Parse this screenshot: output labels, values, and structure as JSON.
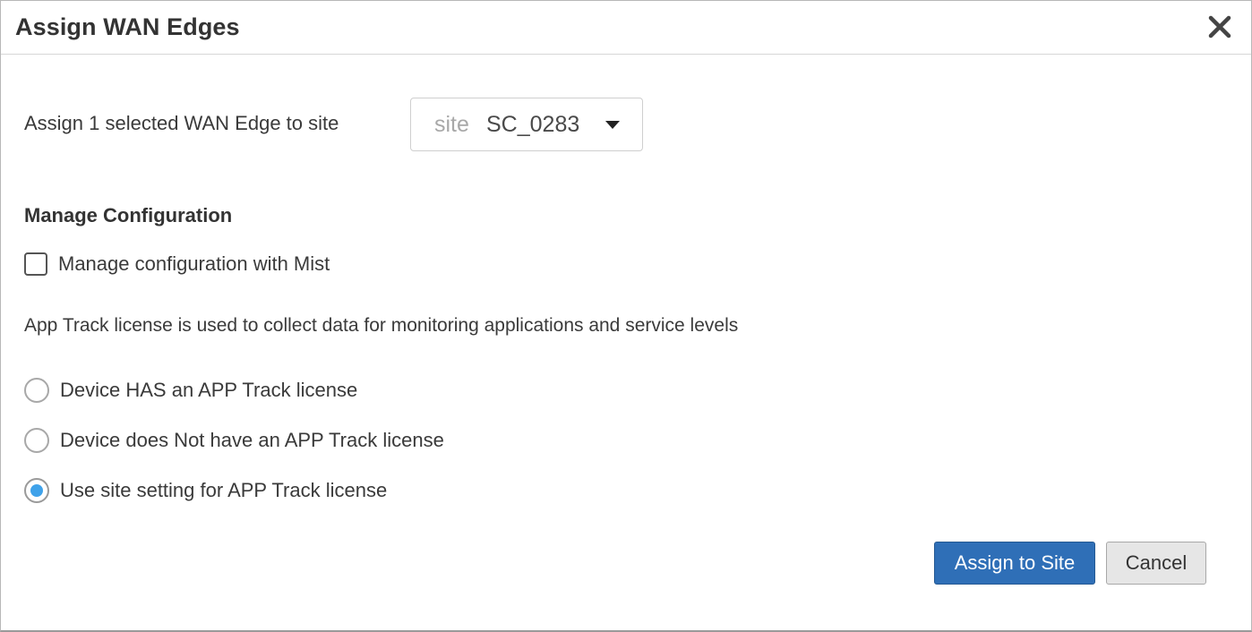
{
  "dialog": {
    "title": "Assign WAN Edges",
    "close_icon": "close-icon"
  },
  "assign": {
    "label": "Assign 1 selected WAN Edge to site",
    "site_select": {
      "prefix": "site",
      "value": "SC_0283",
      "icon": "chevron-down-icon"
    }
  },
  "manage_config": {
    "heading": "Manage Configuration",
    "checkbox_label": "Manage configuration with Mist",
    "checked": false
  },
  "app_track": {
    "note": "App Track license is used to collect data for monitoring applications and service levels",
    "options": [
      {
        "label": "Device HAS an APP Track license",
        "selected": false
      },
      {
        "label": "Device does Not have an APP Track license",
        "selected": false
      },
      {
        "label": "Use site setting for APP Track license",
        "selected": true
      }
    ]
  },
  "actions": {
    "primary_label": "Assign to Site",
    "cancel_label": "Cancel"
  },
  "colors": {
    "primary_button": "#2f6fb7",
    "radio_selected": "#3fa2ea",
    "text": "#333333"
  }
}
